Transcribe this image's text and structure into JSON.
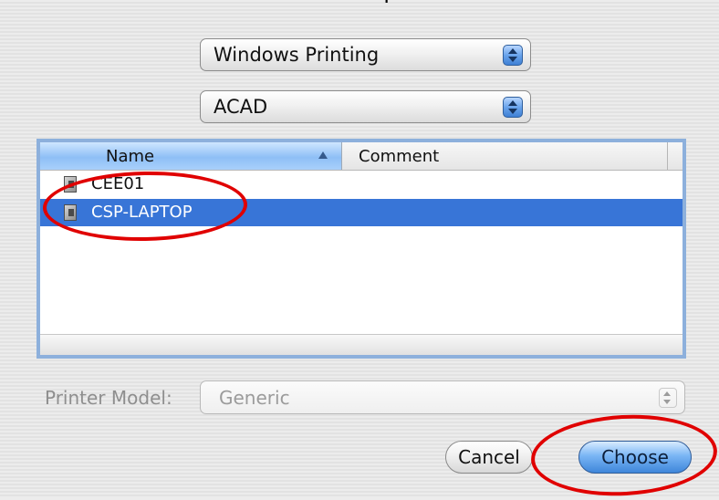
{
  "header": {
    "title_fragment": "p"
  },
  "workgroup_popup": {
    "selected": "Windows Printing"
  },
  "host_popup": {
    "selected": "ACAD"
  },
  "printer_list": {
    "columns": [
      {
        "label": "Name",
        "sort": "ascending"
      },
      {
        "label": "Comment"
      }
    ],
    "rows": [
      {
        "name": "CEE01",
        "comment": "",
        "selected": false
      },
      {
        "name": "CSP-LAPTOP",
        "comment": "",
        "selected": true
      }
    ]
  },
  "printer_model": {
    "label": "Printer Model:",
    "value": "Generic"
  },
  "buttons": {
    "cancel": "Cancel",
    "choose": "Choose"
  },
  "colors": {
    "selection": "#3875d7",
    "annotation": "#e00000",
    "aqua_blue": "#7bb6f5"
  }
}
